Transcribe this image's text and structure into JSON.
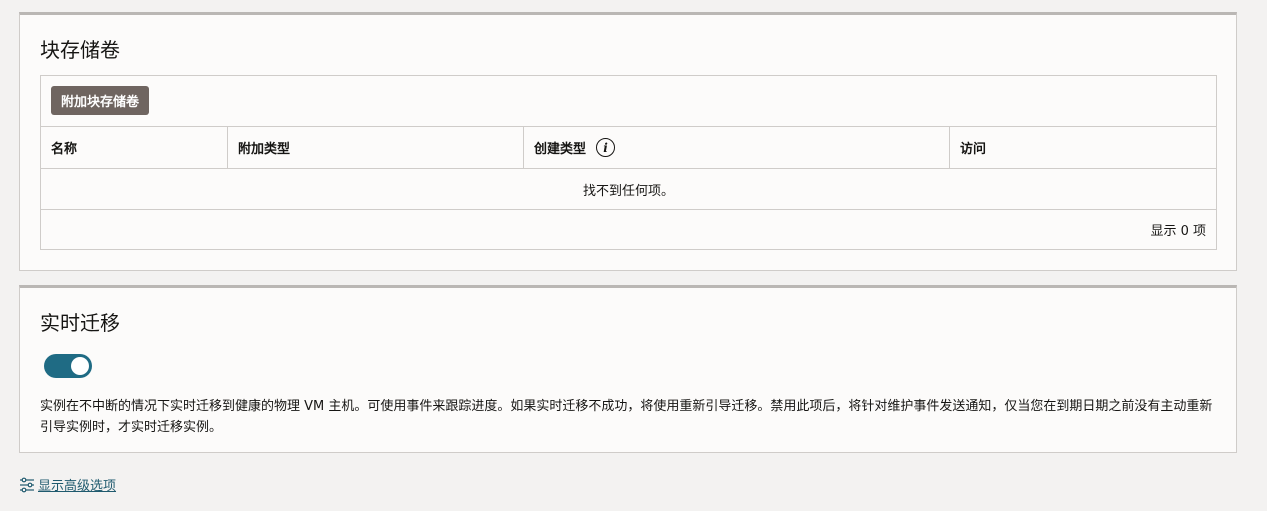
{
  "block_volumes": {
    "title": "块存储卷",
    "attach_button": "附加块存储卷",
    "columns": [
      "名称",
      "附加类型",
      "创建类型",
      "访问"
    ],
    "empty_message": "找不到任何项。",
    "footer_count": "显示 0 项"
  },
  "live_migration": {
    "title": "实时迁移",
    "toggle_on": true,
    "description": "实例在不中断的情况下实时迁移到健康的物理 VM 主机。可使用事件来跟踪进度。如果实时迁移不成功，将使用重新引导迁移。禁用此项后，将针对维护事件发送通知，仅当您在到期日期之前没有主动重新引导实例时，才实时迁移实例。"
  },
  "advanced_link": "显示高级选项",
  "colors": {
    "toggle_on": "#1f6b84",
    "button": "#6f6560",
    "link": "#1f5a6e"
  }
}
